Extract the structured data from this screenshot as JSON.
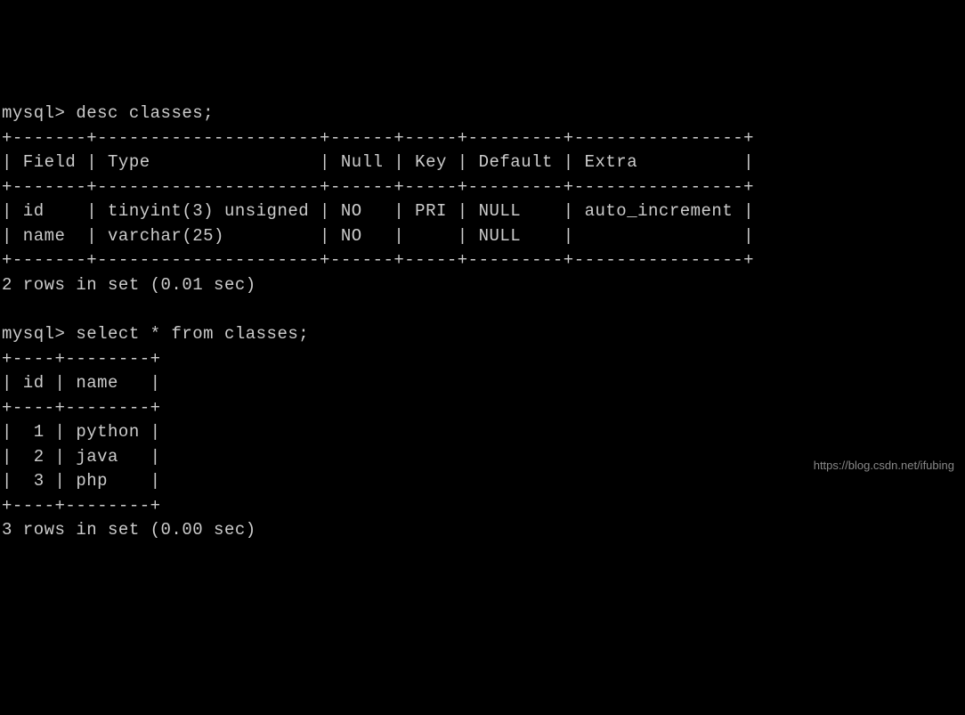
{
  "prompt": "mysql>",
  "commands": {
    "desc": "desc classes;",
    "select": "select * from classes;"
  },
  "desc_table": {
    "border_top": "+-------+---------------------+------+-----+---------+----------------+",
    "header_row": "| Field | Type                | Null | Key | Default | Extra          |",
    "border_mid": "+-------+---------------------+------+-----+---------+----------------+",
    "rows": [
      "| id    | tinyint(3) unsigned | NO   | PRI | NULL    | auto_increment |",
      "| name  | varchar(25)         | NO   |     | NULL    |                |"
    ],
    "border_bot": "+-------+---------------------+------+-----+---------+----------------+",
    "headers": [
      "Field",
      "Type",
      "Null",
      "Key",
      "Default",
      "Extra"
    ],
    "data": [
      {
        "Field": "id",
        "Type": "tinyint(3) unsigned",
        "Null": "NO",
        "Key": "PRI",
        "Default": "NULL",
        "Extra": "auto_increment"
      },
      {
        "Field": "name",
        "Type": "varchar(25)",
        "Null": "NO",
        "Key": "",
        "Default": "NULL",
        "Extra": ""
      }
    ]
  },
  "desc_status": "2 rows in set (0.01 sec)",
  "select_table": {
    "border_top": "+----+--------+",
    "header_row": "| id | name   |",
    "border_mid": "+----+--------+",
    "rows": [
      "|  1 | python |",
      "|  2 | java   |",
      "|  3 | php    |"
    ],
    "border_bot": "+----+--------+",
    "headers": [
      "id",
      "name"
    ],
    "data": [
      {
        "id": 1,
        "name": "python"
      },
      {
        "id": 2,
        "name": "java"
      },
      {
        "id": 3,
        "name": "php"
      }
    ]
  },
  "select_status": "3 rows in set (0.00 sec)",
  "watermark": "https://blog.csdn.net/ifubing"
}
